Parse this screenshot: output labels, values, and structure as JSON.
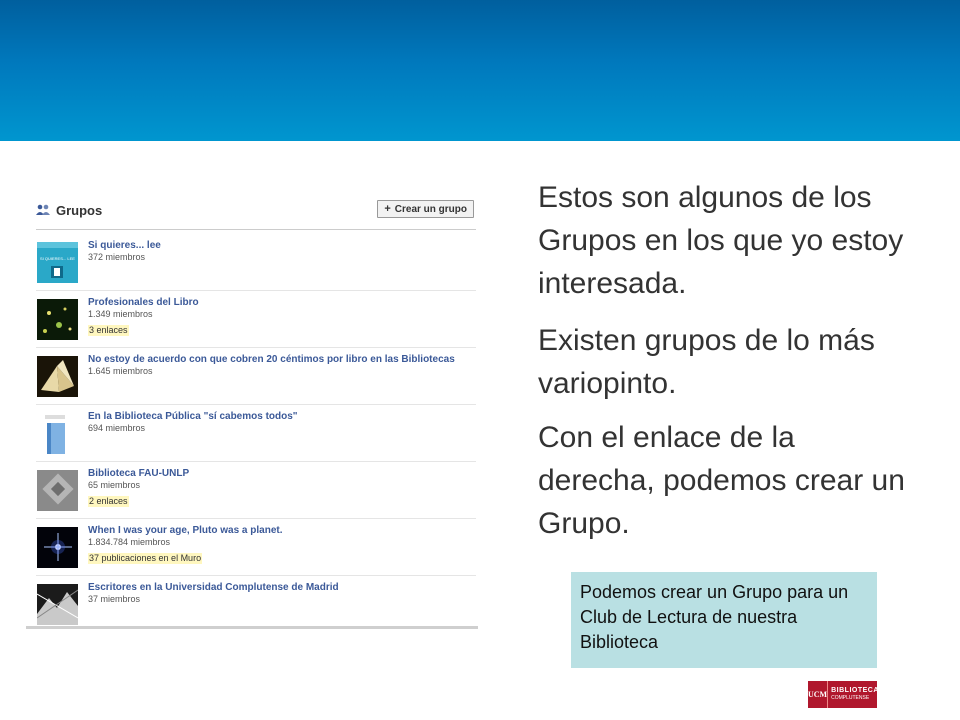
{
  "colors": {
    "banner_top": "#005f9e",
    "banner_bottom": "#0096cf",
    "link_blue": "#3b5998",
    "note_bg": "#b9e0e3",
    "logo_red": "#b0172d"
  },
  "fb": {
    "title": "Grupos",
    "create_button": "Crear un grupo",
    "groups": [
      {
        "name": "Si quieres... lee",
        "members": "372 miembros",
        "extra": ""
      },
      {
        "name": "Profesionales del Libro",
        "members": "1.349 miembros",
        "extra": "3 enlaces"
      },
      {
        "name": "No estoy de acuerdo con que cobren 20 céntimos por libro en las Bibliotecas",
        "members": "1.645 miembros",
        "extra": ""
      },
      {
        "name": "En la Biblioteca Pública \"sí cabemos todos\"",
        "members": "694 miembros",
        "extra": ""
      },
      {
        "name": "Biblioteca FAU-UNLP",
        "members": "65 miembros",
        "extra": "2 enlaces"
      },
      {
        "name": "When I was your age, Pluto was a planet.",
        "members": "1.834.784 miembros",
        "extra": "37 publicaciones en el Muro"
      },
      {
        "name": "Escritores en la Universidad Complutense de Madrid",
        "members": "37 miembros",
        "extra": ""
      }
    ],
    "thumb1_text": "SI QUIERES... LEE"
  },
  "text": {
    "p1": "Estos son algunos de los Grupos en los que yo estoy interesada.",
    "p2": "Existen grupos de lo más variopinto.",
    "p3": "Con el enlace de la derecha, podemos crear un Grupo.",
    "note": "Podemos crear un Grupo para un Club de Lectura de nuestra Biblioteca"
  },
  "logo": {
    "mark": "UCM",
    "line1": "BIBLIOTECA",
    "line2": "COMPLUTENSE"
  }
}
